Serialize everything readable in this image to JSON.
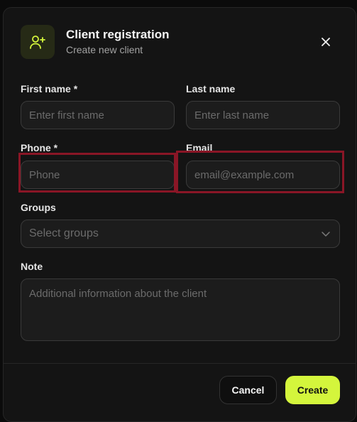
{
  "dialog": {
    "title": "Client registration",
    "subtitle": "Create new client",
    "icon": "user-plus-icon",
    "close_icon": "close-icon"
  },
  "form": {
    "first_name": {
      "label": "First name *",
      "placeholder": "Enter first name",
      "value": ""
    },
    "last_name": {
      "label": "Last name",
      "placeholder": "Enter last name",
      "value": ""
    },
    "phone": {
      "label": "Phone *",
      "placeholder": "Phone",
      "value": ""
    },
    "email": {
      "label": "Email",
      "placeholder": "email@example.com",
      "value": ""
    },
    "groups": {
      "label": "Groups",
      "placeholder": "Select groups"
    },
    "note": {
      "label": "Note",
      "placeholder": "Additional information about the client",
      "value": ""
    }
  },
  "actions": {
    "cancel_label": "Cancel",
    "create_label": "Create"
  },
  "colors": {
    "accent": "#d4f53c",
    "highlight": "#8a1626",
    "background": "#141414"
  }
}
